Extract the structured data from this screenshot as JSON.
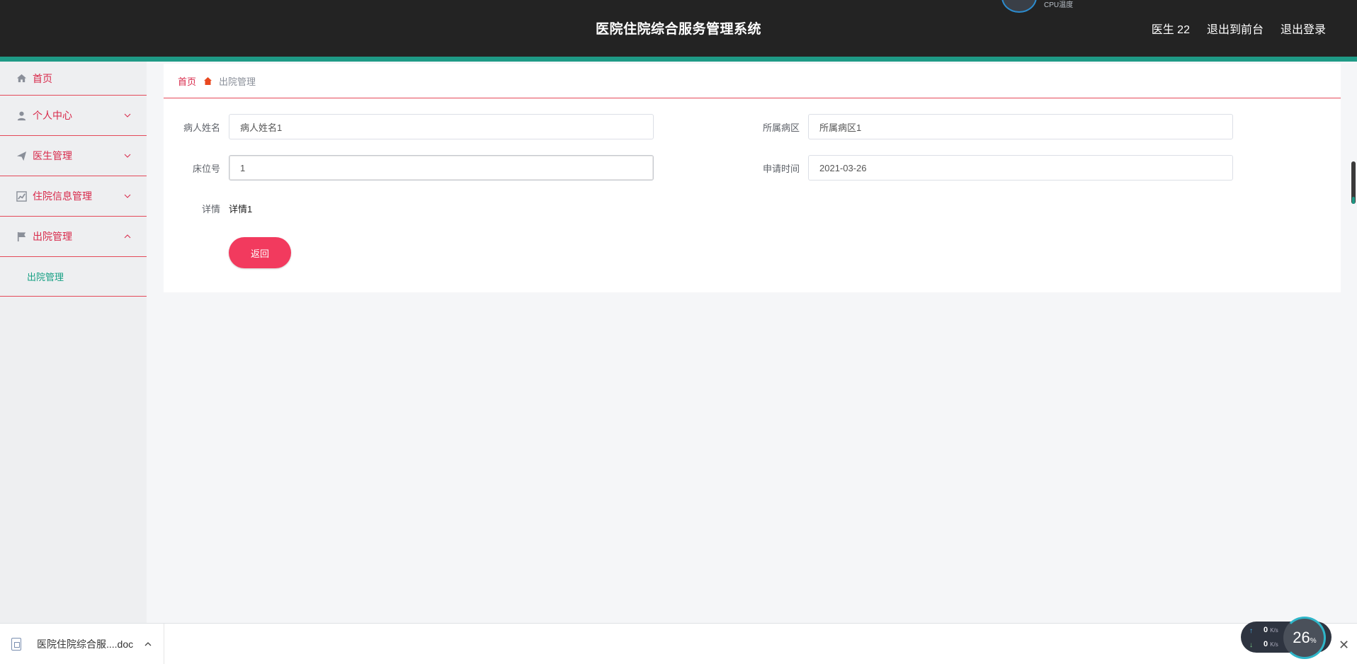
{
  "header": {
    "title": "医院住院综合服务管理系统",
    "user": "医生 22",
    "to_front": "退出到前台",
    "logout": "退出登录",
    "cpu_label": "CPU温度"
  },
  "sidebar": {
    "items": [
      {
        "label": "首页",
        "icon": "home-icon"
      },
      {
        "label": "个人中心",
        "icon": "user-icon"
      },
      {
        "label": "医生管理",
        "icon": "send-icon"
      },
      {
        "label": "住院信息管理",
        "icon": "chart-icon"
      },
      {
        "label": "出院管理",
        "icon": "flag-icon"
      }
    ],
    "sub_item": "出院管理"
  },
  "breadcrumb": {
    "home": "首页",
    "current": "出院管理"
  },
  "form": {
    "patient_name_label": "病人姓名",
    "patient_name_value": "病人姓名1",
    "ward_label": "所属病区",
    "ward_value": "所属病区1",
    "bed_label": "床位号",
    "bed_value": "1",
    "apply_time_label": "申请时间",
    "apply_time_value": "2021-03-26",
    "detail_label": "详情",
    "detail_value": "详情1",
    "back_button": "返回"
  },
  "download_bar": {
    "file_name": "医院住院综合服....doc",
    "close": "✕"
  },
  "net_widget": {
    "up_value": "0",
    "up_unit": "K/s",
    "down_value": "0",
    "down_unit": "K/s",
    "cpu_value": "26",
    "cpu_unit": "%"
  },
  "colors": {
    "accent": "#d8294a",
    "header_bg": "#232323",
    "teal": "#1e9a86",
    "button": "#f23a5e"
  }
}
